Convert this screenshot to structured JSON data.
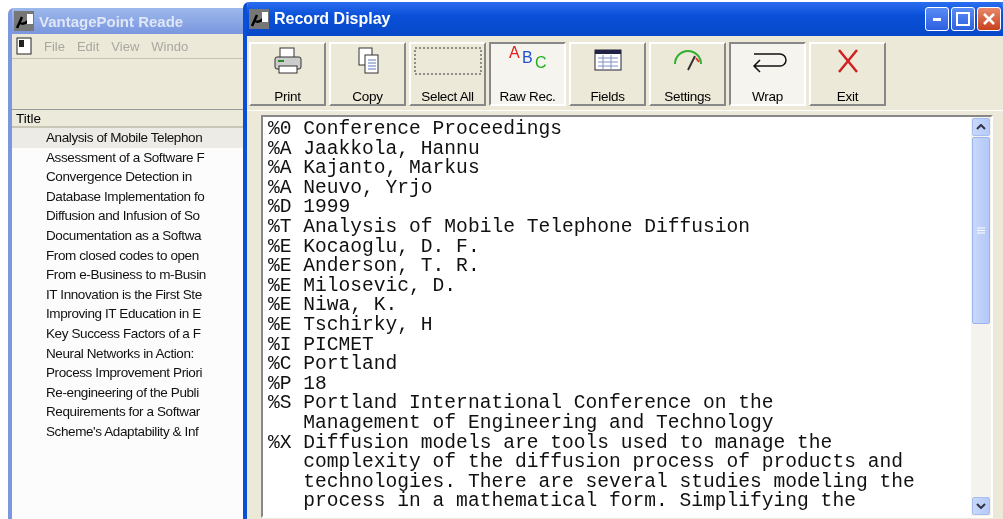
{
  "back_window": {
    "title": "VantagePoint Reade",
    "active": false,
    "menu": [
      "File",
      "Edit",
      "View",
      "Windo"
    ],
    "list": {
      "column": "Title",
      "rows": [
        {
          "text": "Analysis of Mobile Telephon",
          "selected": true
        },
        {
          "text": "Assessment of a Software F",
          "selected": false
        },
        {
          "text": "Convergence Detection in",
          "selected": false
        },
        {
          "text": "Database Implementation fo",
          "selected": false
        },
        {
          "text": "Diffusion and Infusion of So",
          "selected": false
        },
        {
          "text": "Documentation as a Softwa",
          "selected": false
        },
        {
          "text": "From closed codes to open",
          "selected": false
        },
        {
          "text": "From e-Business to m-Busin",
          "selected": false
        },
        {
          "text": "IT Innovation is the First Ste",
          "selected": false
        },
        {
          "text": "Improving IT Education in E",
          "selected": false
        },
        {
          "text": "Key Success Factors of a F",
          "selected": false
        },
        {
          "text": "Neural Networks in Action:",
          "selected": false
        },
        {
          "text": "Process Improvement Priori",
          "selected": false
        },
        {
          "text": "Re-engineering of the Publi",
          "selected": false
        },
        {
          "text": "Requirements for a Softwar",
          "selected": false
        },
        {
          "text": "Scheme's Adaptability & Inf",
          "selected": false
        }
      ]
    }
  },
  "record_window": {
    "title": "Record Display",
    "active": true,
    "toolbar": [
      {
        "kind": "print",
        "label": "Print",
        "pressed": false
      },
      {
        "kind": "copy",
        "label": "Copy",
        "pressed": false
      },
      {
        "kind": "select_all",
        "label": "Select All",
        "pressed": false
      },
      {
        "kind": "raw",
        "label": "Raw Rec.",
        "pressed": true,
        "icon_letters": [
          "A",
          "B",
          "C"
        ]
      },
      {
        "kind": "fields",
        "label": "Fields",
        "pressed": false
      },
      {
        "kind": "settings",
        "label": "Settings",
        "pressed": false
      },
      {
        "kind": "wrap",
        "label": "Wrap",
        "pressed": true
      },
      {
        "kind": "exit",
        "label": "Exit",
        "pressed": false
      }
    ],
    "record": [
      {
        "tag": "%0",
        "lines": [
          "Conference Proceedings"
        ]
      },
      {
        "tag": "%A",
        "lines": [
          "Jaakkola, Hannu"
        ]
      },
      {
        "tag": "%A",
        "lines": [
          "Kajanto, Markus"
        ]
      },
      {
        "tag": "%A",
        "lines": [
          "Neuvo, Yrjo"
        ]
      },
      {
        "tag": "%D",
        "lines": [
          "1999"
        ]
      },
      {
        "tag": "%T",
        "lines": [
          "Analysis of Mobile Telephone Diffusion"
        ]
      },
      {
        "tag": "%E",
        "lines": [
          "Kocaoglu, D. F."
        ]
      },
      {
        "tag": "%E",
        "lines": [
          "Anderson, T. R."
        ]
      },
      {
        "tag": "%E",
        "lines": [
          "Milosevic, D."
        ]
      },
      {
        "tag": "%E",
        "lines": [
          "Niwa, K."
        ]
      },
      {
        "tag": "%E",
        "lines": [
          "Tschirky, H"
        ]
      },
      {
        "tag": "%I",
        "lines": [
          "PICMET"
        ]
      },
      {
        "tag": "%C",
        "lines": [
          "Portland"
        ]
      },
      {
        "tag": "%P",
        "lines": [
          "18"
        ]
      },
      {
        "tag": "%S",
        "lines": [
          "Portland International Conference on the",
          "Management of Engineering and Technology"
        ]
      },
      {
        "tag": "%X",
        "lines": [
          "Diffusion models are tools used to manage the",
          "complexity of the diffusion process of products and",
          "technologies. There are several studies modeling the",
          "process in a mathematical form. Simplifying the"
        ]
      }
    ]
  }
}
